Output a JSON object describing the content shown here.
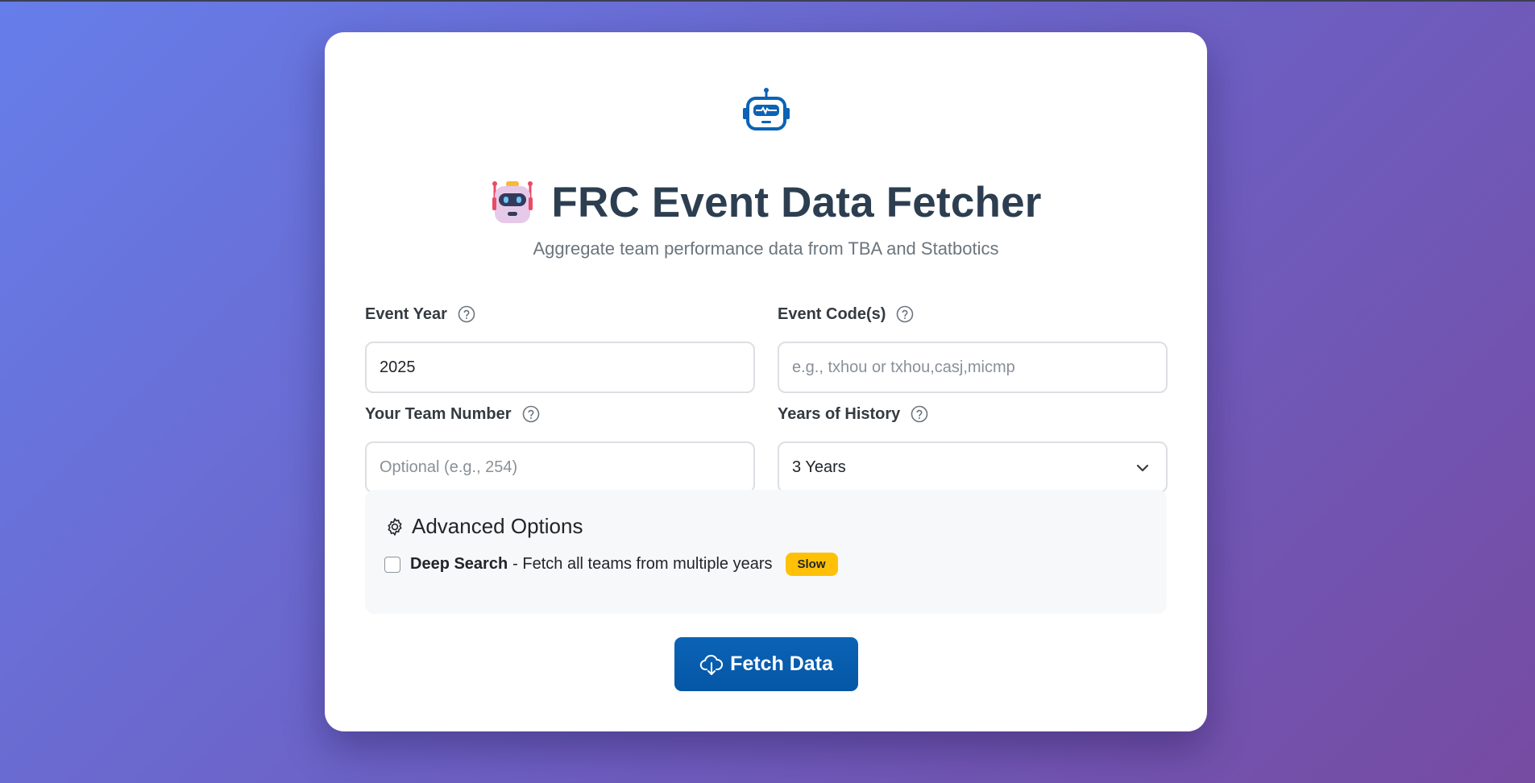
{
  "header": {
    "icon": "robot-icon",
    "title_emoji": "robot-face-emoji",
    "title": "FRC Event Data Fetcher",
    "subtitle": "Aggregate team performance data from TBA and Statbotics"
  },
  "form": {
    "event_year": {
      "label": "Event Year",
      "value": "2025",
      "help_icon": "question-circle-icon"
    },
    "event_codes": {
      "label": "Event Code(s)",
      "value": "",
      "placeholder": "e.g., txhou or txhou,casj,micmp",
      "help_icon": "question-circle-icon"
    },
    "team_number": {
      "label": "Your Team Number",
      "value": "",
      "placeholder": "Optional (e.g., 254)",
      "help_icon": "question-circle-icon"
    },
    "years_history": {
      "label": "Years of History",
      "selected": "3 Years",
      "help_icon": "question-circle-icon"
    }
  },
  "advanced": {
    "icon": "gear-icon",
    "title": "Advanced Options",
    "deep_search": {
      "checked": false,
      "label_bold": "Deep Search",
      "label_rest": "- Fetch all teams from multiple years",
      "badge": "Slow"
    }
  },
  "action": {
    "icon": "cloud-download-icon",
    "label": "Fetch Data"
  },
  "colors": {
    "primary": "#0556a6",
    "title": "#2c3e50",
    "badge": "#ffc107",
    "bg_start": "#667eea",
    "bg_end": "#764ba2"
  }
}
